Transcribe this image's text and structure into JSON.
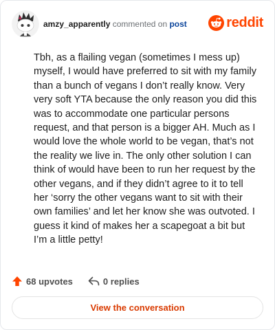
{
  "header": {
    "username": "amzy_apparently",
    "action": "commented on",
    "post_link": "post",
    "brand": "reddit"
  },
  "comment": {
    "text": "Tbh, as a flailing vegan (sometimes I mess up) myself, I would have preferred to sit with my family than a bunch of vegans I don’t really know. Very very soft YTA because the only reason you did this was to accommodate one particular persons request, and that person is a bigger AH. Much as I would love the whole world to be vegan, that’s not the reality we live in. The only other solution I can think of would have been to run her request by the other vegans, and if they didn’t agree to it to tell her ‘sorry the other vegans want to sit with their own families’ and let her know she was outvoted. I guess it kind of makes her a scapegoat a bit but I’m a little petty!"
  },
  "stats": {
    "upvotes": "68 upvotes",
    "replies": "0 replies"
  },
  "cta": {
    "label": "View the conversation"
  },
  "colors": {
    "brand": "#ff4500",
    "link": "#0a449b",
    "cta_text": "#d93a00",
    "upvote_icon": "#ff4500"
  },
  "icons": {
    "avatar": "snoo-avatar",
    "logo": "reddit-logo-icon",
    "upvote": "upvote-arrow-icon",
    "reply": "reply-arrow-icon"
  }
}
